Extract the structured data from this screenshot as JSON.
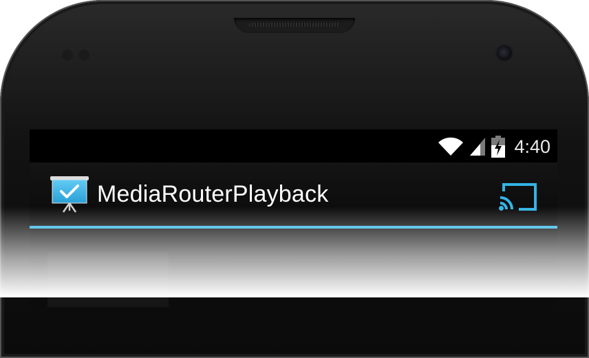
{
  "status_bar": {
    "time": "4:40",
    "icons": [
      "wifi-icon",
      "signal-icon",
      "battery-charging-icon"
    ]
  },
  "action_bar": {
    "app_icon": "presentation-checkmark-icon",
    "title": "MediaRouterPlayback",
    "cast_icon": "cast-icon"
  },
  "colors": {
    "accent": "#33b5e5",
    "app_icon_blue": "#41b7ec",
    "status_text": "#e9e9e9",
    "bar_background": "#000000"
  }
}
